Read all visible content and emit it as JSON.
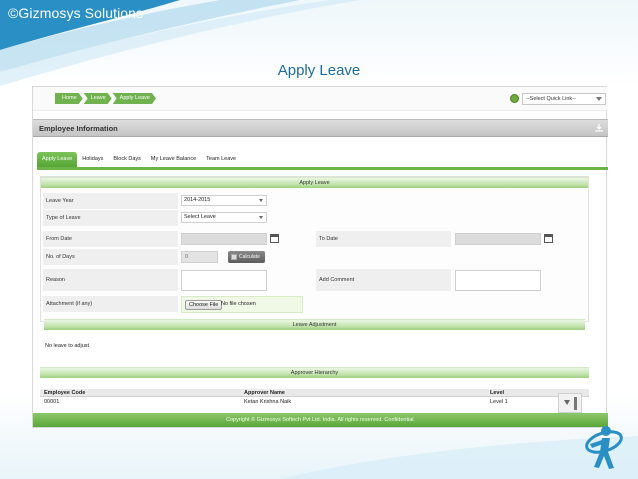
{
  "slide": {
    "copyright": "©Gizmosys Solutions",
    "title": "Apply Leave"
  },
  "breadcrumb": [
    "Home",
    "Leave",
    "Apply Leave"
  ],
  "quick_link": {
    "selected": "--Select Quick Link--"
  },
  "employee_info": {
    "title": "Employee Information"
  },
  "tabs": [
    {
      "label": "Apply Leave",
      "active": true
    },
    {
      "label": "Holidays",
      "active": false
    },
    {
      "label": "Block Days",
      "active": false
    },
    {
      "label": "My Leave Balance",
      "active": false
    },
    {
      "label": "Team Leave",
      "active": false
    }
  ],
  "form": {
    "title": "Apply Leave",
    "leave_year": {
      "label": "Leave Year",
      "value": "2014-2015"
    },
    "type_of_leave": {
      "label": "Type of Leave",
      "value": "Select Leave"
    },
    "from_date": {
      "label": "From Date",
      "value": ""
    },
    "to_date": {
      "label": "To Date",
      "value": ""
    },
    "no_of_days": {
      "label": "No. of Days",
      "value": "0"
    },
    "calculate_button": "Calculate",
    "reason": {
      "label": "Reason",
      "value": ""
    },
    "add_comment": {
      "label": "Add Comment",
      "value": ""
    },
    "attachment": {
      "label": "Attachment (if any)",
      "choose_button": "Choose File",
      "status": "No file chosen"
    }
  },
  "leave_adjustment": {
    "title": "Leave Adjustment",
    "message": "No leave to adjust"
  },
  "approver_hierarchy": {
    "title": "Approver Hierarchy",
    "columns": [
      "Employee Code",
      "Approver Name",
      "Level"
    ],
    "rows": [
      [
        "00001",
        "Ketan Krishna Naik",
        "Level 1"
      ]
    ]
  },
  "footer": {
    "text": "Copyright © Gizmosys Softech Pvt Ltd. India. All rights reserved. Confidential."
  },
  "colors": {
    "accent_green": "#6cb449",
    "slide_blue": "#2a8fc4",
    "title_blue": "#1f6a9a"
  }
}
